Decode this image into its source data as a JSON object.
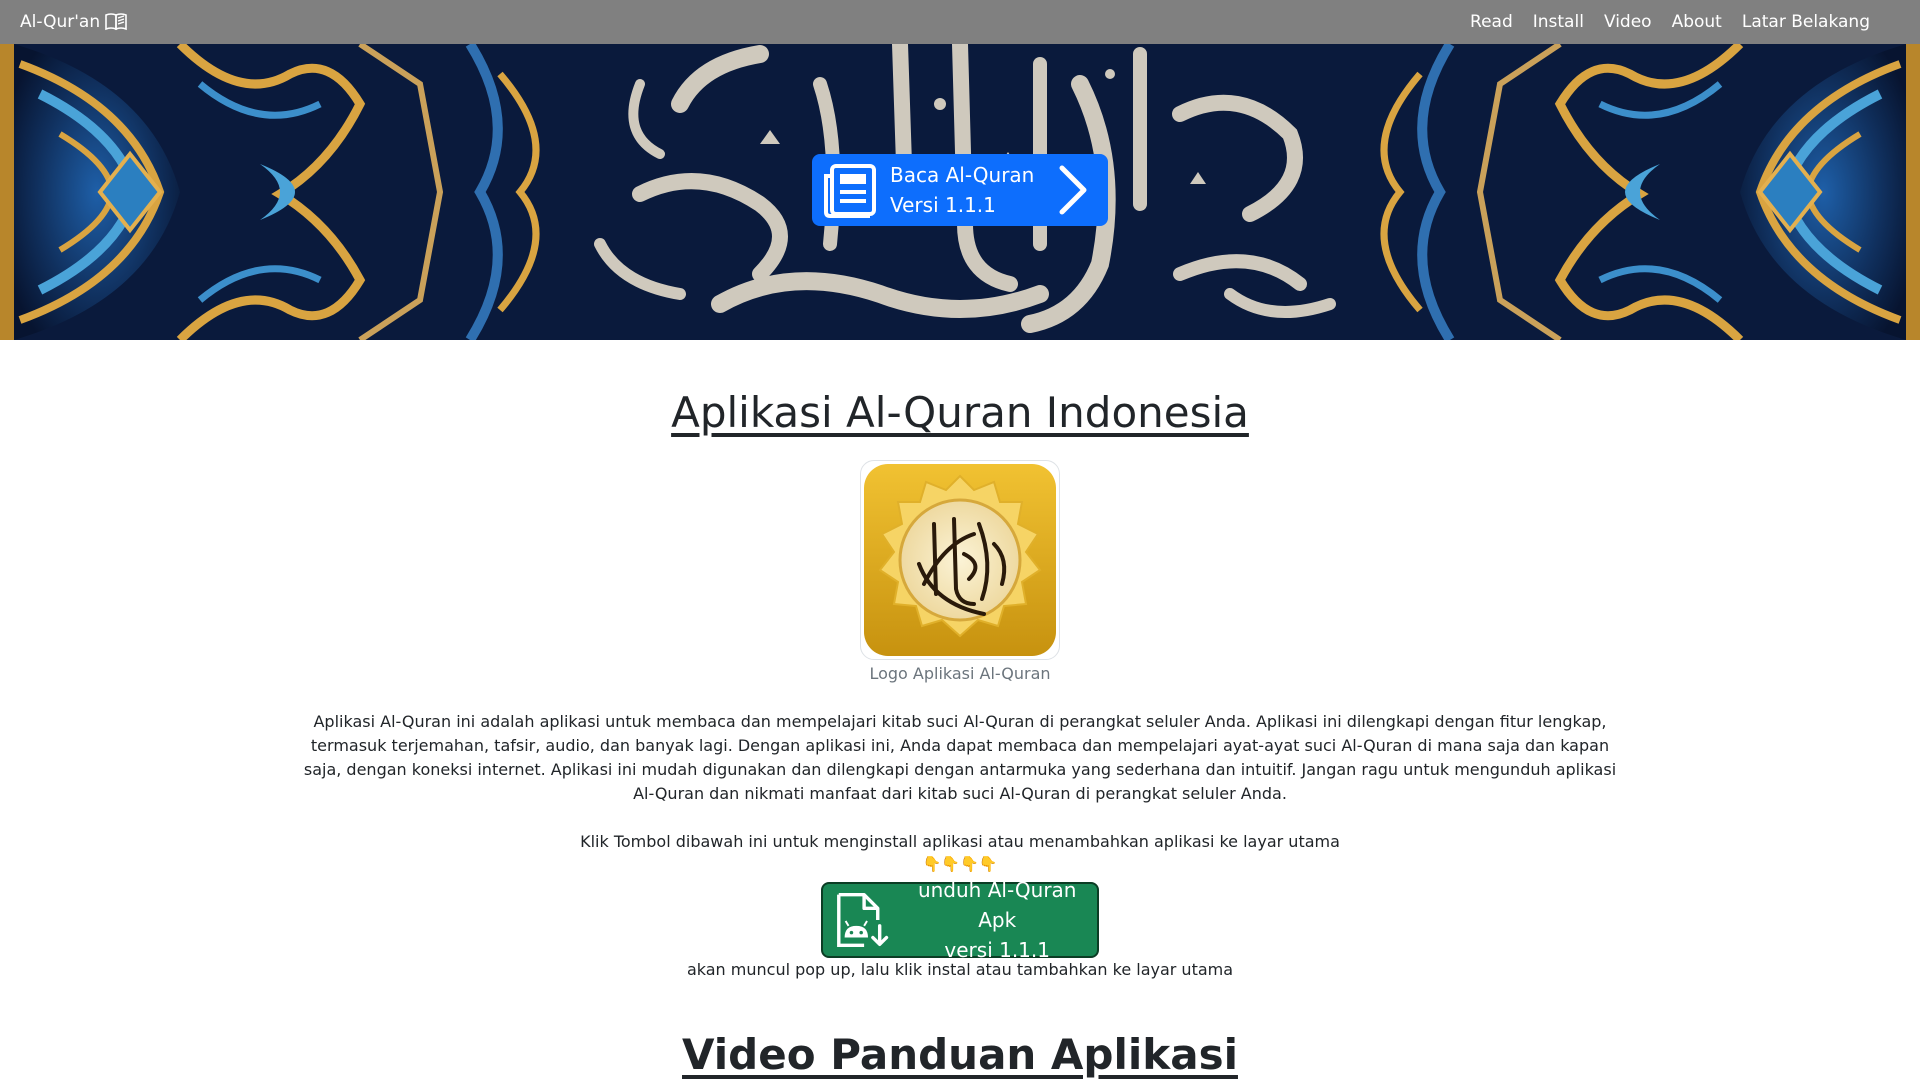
{
  "navbar": {
    "brand": "Al-Qur'an",
    "links": [
      "Read",
      "Install",
      "Video",
      "About",
      "Latar Belakang"
    ]
  },
  "hero": {
    "read_button": {
      "line1": "Baca Al-Quran",
      "line2": "Versi 1.1.1"
    }
  },
  "main": {
    "title": "Aplikasi Al-Quran Indonesia",
    "logo_caption": "Logo Aplikasi Al-Quran",
    "description": "Aplikasi Al-Quran ini adalah aplikasi untuk membaca dan mempelajari kitab suci Al-Quran di perangkat seluler Anda. Aplikasi ini dilengkapi dengan fitur lengkap, termasuk terjemahan, tafsir, audio, dan banyak lagi. Dengan aplikasi ini, Anda dapat membaca dan mempelajari ayat-ayat suci Al-Quran di mana saja dan kapan saja, dengan koneksi internet. Aplikasi ini mudah digunakan dan dilengkapi dengan antarmuka yang sederhana dan intuitif. Jangan ragu untuk mengunduh aplikasi Al-Quran dan nikmati manfaat dari kitab suci Al-Quran di perangkat seluler Anda.",
    "click_info": "Klik Tombol dibawah ini untuk menginstall aplikasi atau menambahkan aplikasi ke layar utama",
    "hands": "👇👇👇👇",
    "download_button": {
      "line1": "unduh Al-Quran Apk",
      "line2": "versi 1.1.1"
    },
    "popup_note": "akan muncul pop up, lalu klik instal atau tambahkan ke layar utama",
    "video_title": "Video Panduan Aplikasi"
  },
  "colors": {
    "navbar": "#808080",
    "primary": "#0d6efd",
    "success": "#198754"
  },
  "icons": {
    "brand": "book-open-icon",
    "read_button": "newspaper-icon",
    "chevron": "chevron-right-icon",
    "download": "android-file-download-icon"
  }
}
